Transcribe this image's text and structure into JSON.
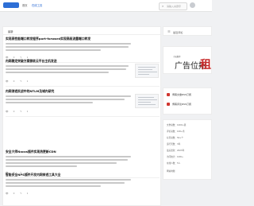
{
  "nav": {
    "home": "首页",
    "tools": "在线工具"
  },
  "search": {
    "placeholder": "请输入关键字"
  },
  "main": {
    "section_title": "最新"
  },
  "articles": [
    {
      "title": "实现高性能端口转发程序port-forward实现高级流量端口转发",
      "views": "0",
      "comments": "1",
      "more": "查看"
    },
    {
      "title": "内网稳定突破方案微软云平台主机发送",
      "views": "0",
      "comments": "1",
      "more": "查看"
    },
    {
      "title": "内网渗透实战中的NTLM及域内研究",
      "views": "0",
      "comments": "1",
      "more": "查看"
    },
    {
      "title": "安全大师Nacos插件实现热更新CDN",
      "views": "0",
      "comments": "1",
      "more": "查看"
    },
    {
      "title": "智能安全NPS插件开发内网穿透工具大全",
      "views": "0",
      "comments": "1",
      "more": "查看"
    }
  ],
  "sidebar": {
    "recommend_title": "最近评论",
    "ad": {
      "small": "小站推荐",
      "big": "广告位招",
      "red": "租"
    },
    "rss": [
      "博客文章RSS订阅",
      "博客评论RSS订阅"
    ],
    "info": [
      "文章总数：1000+篇",
      "评论总数：100+条",
      "标签总数：50+个",
      "运行天数：3年",
      "最后更新：2023年",
      "访问统计：10W+",
      "在线人数：5人",
      "网站地图"
    ]
  },
  "colors": {
    "accent": "#1a5fd0",
    "brand": "#2d6fd6",
    "ad_red": "#c62828"
  }
}
